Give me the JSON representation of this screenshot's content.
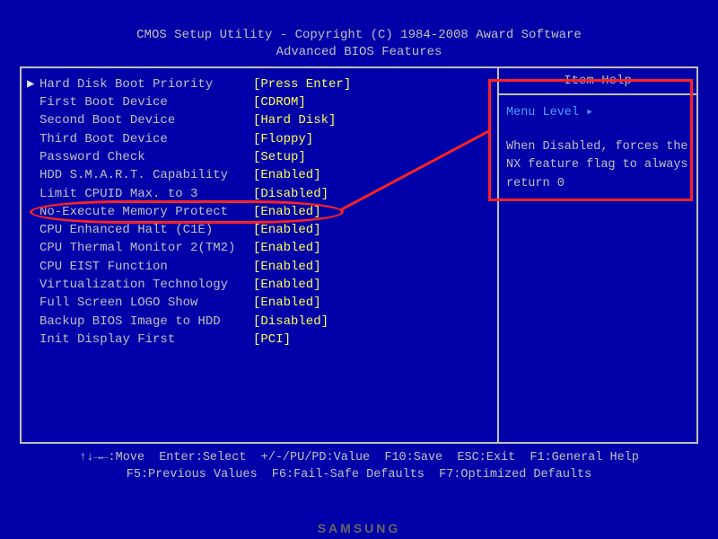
{
  "header": {
    "line1": "CMOS Setup Utility - Copyright (C) 1984-2008 Award Software",
    "line2": "Advanced BIOS Features"
  },
  "settings": [
    {
      "arrow": "▶",
      "label": "Hard Disk Boot Priority",
      "value": "[Press Enter]"
    },
    {
      "arrow": "",
      "label": "First Boot Device",
      "value": "[CDROM]"
    },
    {
      "arrow": "",
      "label": "Second Boot Device",
      "value": "[Hard Disk]"
    },
    {
      "arrow": "",
      "label": "Third Boot Device",
      "value": "[Floppy]"
    },
    {
      "arrow": "",
      "label": "Password Check",
      "value": "[Setup]"
    },
    {
      "arrow": "",
      "label": "HDD S.M.A.R.T. Capability",
      "value": "[Enabled]"
    },
    {
      "arrow": "",
      "label": "Limit CPUID Max. to 3",
      "value": "[Disabled]"
    },
    {
      "arrow": "",
      "label": "No-Execute Memory Protect",
      "value": "[Enabled]"
    },
    {
      "arrow": "",
      "label": "CPU Enhanced Halt (C1E)",
      "value": "[Enabled]"
    },
    {
      "arrow": "",
      "label": "CPU Thermal Monitor 2(TM2)",
      "value": "[Enabled]"
    },
    {
      "arrow": "",
      "label": "CPU EIST Function",
      "value": "[Enabled]"
    },
    {
      "arrow": "",
      "label": "Virtualization Technology",
      "value": "[Enabled]"
    },
    {
      "arrow": "",
      "label": "Full Screen LOGO Show",
      "value": "[Enabled]"
    },
    {
      "arrow": "",
      "label": "Backup BIOS Image to HDD",
      "value": "[Disabled]"
    },
    {
      "arrow": "",
      "label": "Init Display First",
      "value": "[PCI]"
    }
  ],
  "help": {
    "title": "Item Help",
    "menu_level_label": "Menu Level",
    "menu_level_arrow": "▸",
    "text": "When Disabled, forces the NX feature flag to always return 0"
  },
  "footer": {
    "line1": "↑↓→←:Move  Enter:Select  +/-/PU/PD:Value  F10:Save  ESC:Exit  F1:General Help",
    "line2": "F5:Previous Values  F6:Fail-Safe Defaults  F7:Optimized Defaults"
  },
  "brand": "SAMSUNG"
}
